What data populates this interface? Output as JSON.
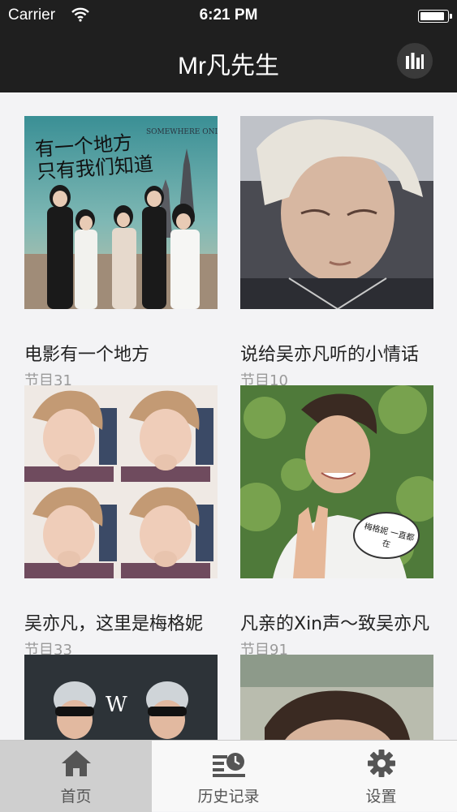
{
  "status_bar": {
    "carrier": "Carrier",
    "time": "6:21 PM",
    "battery_level": 0.95
  },
  "nav_bar": {
    "title": "Mr凡先生",
    "player_icon": "equalizer-icon"
  },
  "albums": [
    {
      "title": "电影有一个地方",
      "count": "节目31",
      "poster_text": "有一个地方 只有我们知道",
      "poster_text_en": "SOMEWHERE ONLY WE KNOW"
    },
    {
      "title": "说给吴亦凡听的小情话",
      "count": "节目10"
    },
    {
      "title": "吴亦凡，这里是梅格妮",
      "count": "节目33"
    },
    {
      "title": "凡亲的Xin声～致吴亦凡",
      "count": "节目91",
      "sign_text": "梅格妮 一直都在"
    },
    {
      "title": "",
      "count": ""
    },
    {
      "title": "",
      "count": ""
    }
  ],
  "tab_bar": {
    "tabs": [
      {
        "label": "首页",
        "icon": "home-icon",
        "active": true
      },
      {
        "label": "历史记录",
        "icon": "history-icon",
        "active": false
      },
      {
        "label": "设置",
        "icon": "gear-icon",
        "active": false
      }
    ]
  },
  "colors": {
    "bar": "#1f1f1f",
    "background": "#f3f3f5",
    "active_tab": "#cfcfcf",
    "tab_icon": "#555555"
  }
}
